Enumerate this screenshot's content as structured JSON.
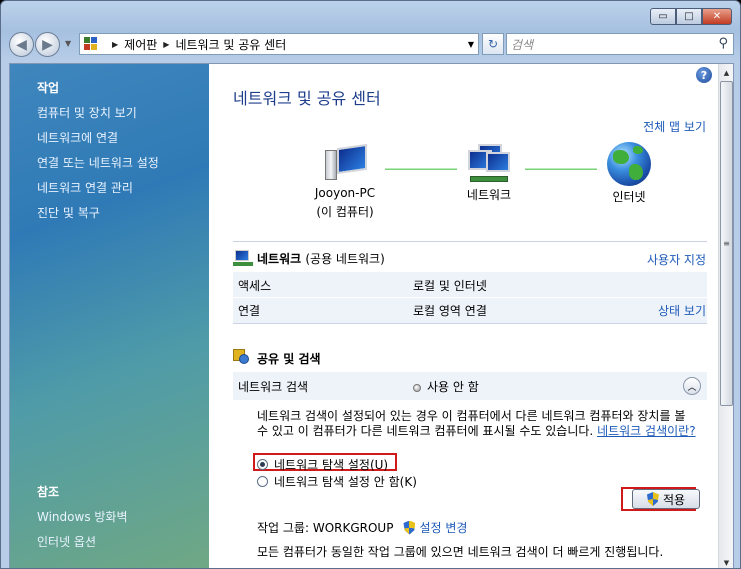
{
  "window": {
    "caption_buttons": {
      "minimize": "▭",
      "maximize": "□",
      "close": "✕"
    }
  },
  "address_bar": {
    "crumbs": [
      "제어판",
      "네트워크 및 공유 센터"
    ],
    "search_placeholder": "검색"
  },
  "left_pane": {
    "tasks_heading": "작업",
    "tasks": [
      "컴퓨터 및 장치 보기",
      "네트워크에 연결",
      "연결 또는 네트워크 설정",
      "네트워크 연결 관리",
      "진단 및 복구"
    ],
    "see_also_heading": "참조",
    "see_also": [
      "Windows 방화벽",
      "인터넷 옵션"
    ]
  },
  "main": {
    "title": "네트워크 및 공유 센터",
    "full_map_link": "전체 맵 보기",
    "map": {
      "computer_name": "Jooyon-PC",
      "computer_sub": "(이 컴퓨터)",
      "network_label": "네트워크",
      "internet_label": "인터넷"
    },
    "network_section": {
      "name": "네트워크",
      "type": "(공용 네트워크)",
      "customize_link": "사용자 지정",
      "rows": [
        {
          "label": "액세스",
          "value": "로컬 및 인터넷",
          "link": ""
        },
        {
          "label": "연결",
          "value": "로컬 영역 연결",
          "link": "상태 보기"
        }
      ]
    },
    "sharing_section": {
      "heading": "공유 및 검색",
      "discovery_label": "네트워크 검색",
      "discovery_status": "사용 안 함",
      "description": "네트워크 검색이 설정되어 있는 경우 이 컴퓨터에서 다른 네트워크 컴퓨터와 장치를 볼 수 있고 이 컴퓨터가 다른 네트워크 컴퓨터에 표시될 수도 있습니다.",
      "description_link": "네트워크 검색이란?",
      "option_on": "네트워크 탐색 설정(U)",
      "option_off": "네트워크 탐색 설정 안 함(K)",
      "apply_button": "적용",
      "workgroup_text": "작업 그룹: WORKGROUP",
      "change_settings_link": "설정 변경",
      "footer_text": "모든 컴퓨터가 동일한 작업 그룹에 있으면 네트워크 검색이 더 빠르게 진행됩니다."
    }
  },
  "colors": {
    "title_blue": "#1e3e8c",
    "link_blue": "#1e5bb8",
    "highlight_red": "#d01a1a"
  }
}
